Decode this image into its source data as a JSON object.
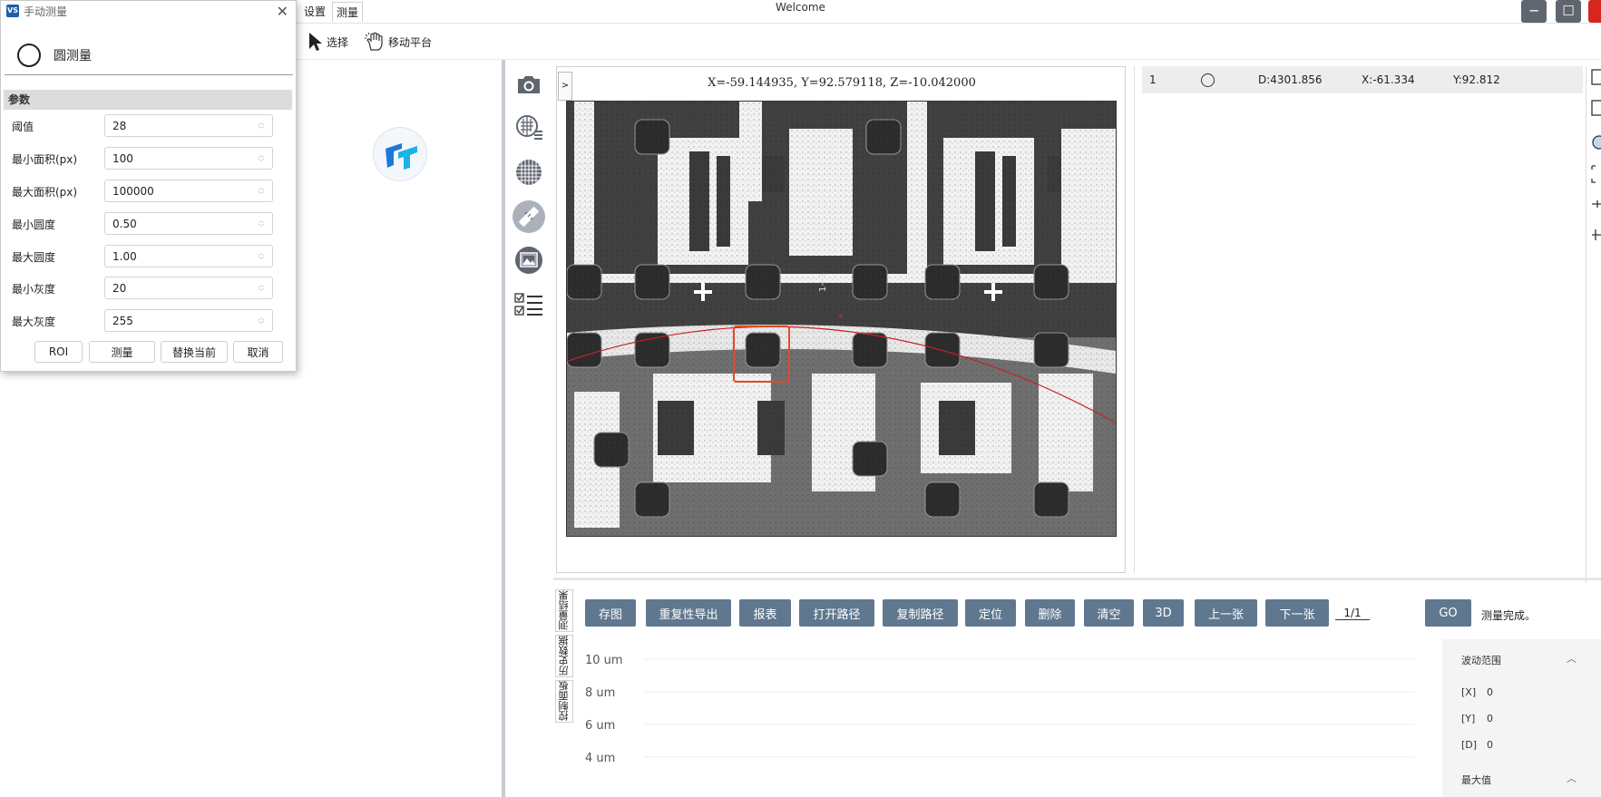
{
  "window": {
    "title": "Welcome",
    "menu_tabs": [
      {
        "label": "设置"
      },
      {
        "label": "测量"
      }
    ]
  },
  "toolbar": {
    "select_label": "选择",
    "move_label": "移动平台"
  },
  "dialog": {
    "title": "手动测量",
    "app_icon_text": "VS",
    "heading": "圆测量",
    "section_label": "参数",
    "params": [
      {
        "label": "阈值",
        "value": "28"
      },
      {
        "label": "最小面积(px)",
        "value": "100"
      },
      {
        "label": "最大面积(px)",
        "value": "100000"
      },
      {
        "label": "最小圆度",
        "value": "0.50"
      },
      {
        "label": "最大圆度",
        "value": "1.00"
      },
      {
        "label": "最小灰度",
        "value": "20"
      },
      {
        "label": "最大灰度",
        "value": "255"
      }
    ],
    "buttons": {
      "roi": "ROI",
      "measure": "测量",
      "replace": "替换当前",
      "cancel": "取消"
    }
  },
  "image_panel": {
    "expand_label": ">",
    "coordinates": "X=-59.144935, Y=92.579118, Z=-10.042000",
    "overlay_text": "1+3"
  },
  "results": {
    "rows": [
      {
        "index": "1",
        "d": "D:4301.856",
        "x": "X:-61.334",
        "y": "Y:92.812"
      }
    ]
  },
  "bottom": {
    "vertical_tabs": [
      {
        "label": "测量结果"
      },
      {
        "label": "历史数据"
      },
      {
        "label": "控制面板"
      }
    ],
    "actions": {
      "save_image": "存图",
      "repeat_export": "重复性导出",
      "report": "报表",
      "open_path": "打开路径",
      "copy_path": "复制路径",
      "locate": "定位",
      "delete": "删除",
      "clear": "清空",
      "view_3d": "3D",
      "prev": "上一张",
      "next": "下一张",
      "go": "GO"
    },
    "page_indicator": "1/1",
    "status": "测量完成。",
    "chart_data": {
      "type": "line",
      "title": "",
      "xlabel": "",
      "ylabel": "",
      "y_ticks": [
        "10 um",
        "8 um",
        "6 um",
        "4 um"
      ],
      "series": []
    },
    "range_panel": {
      "title": "波动范围",
      "items": [
        {
          "label": "[X]",
          "value": "0"
        },
        {
          "label": "[Y]",
          "value": "0"
        },
        {
          "label": "[D]",
          "value": "0"
        }
      ],
      "max_title": "最大值"
    }
  },
  "colors": {
    "action_button": "#60788f",
    "accent_red": "#d6261d",
    "roi_box": "#e8452a",
    "fit_arc": "#c8202a",
    "active_icon": "#aab1ba"
  },
  "icons": {
    "sidebar": [
      "camera-icon",
      "grid-settings-icon",
      "mesh-grid-icon",
      "ruler-icon",
      "image-frame-icon",
      "checklist-icon"
    ],
    "toolbar": [
      "cursor-icon",
      "hand-icon"
    ]
  }
}
